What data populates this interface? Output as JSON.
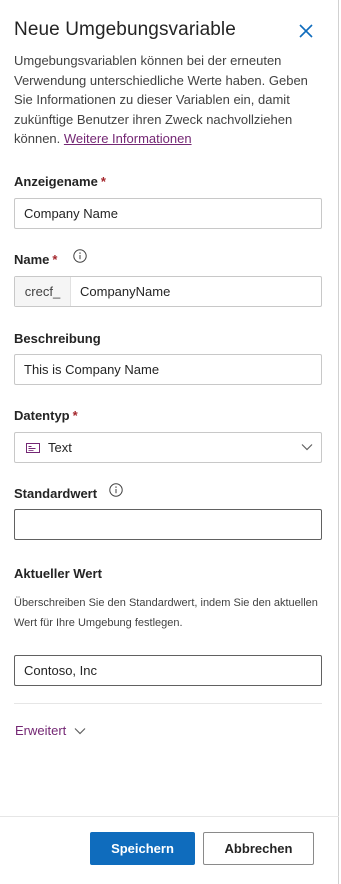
{
  "header": {
    "title": "Neue Umgebungsvariable",
    "close_icon": "close-icon"
  },
  "description": {
    "text": "Umgebungsvariablen können bei der erneuten Verwendung unterschiedliche Werte haben. Geben Sie Informationen zu dieser Variablen ein, damit zukünftige Benutzer ihren Zweck nachvollziehen können.",
    "link": "Weitere Informationen"
  },
  "fields": {
    "display_name": {
      "label": "Anzeigename",
      "required": "*",
      "value": "Company Name"
    },
    "name": {
      "label": "Name",
      "required": "*",
      "prefix": "crecf_",
      "value": "CompanyName",
      "info_icon": "info-icon"
    },
    "description": {
      "label": "Beschreibung",
      "value": "This is Company Name"
    },
    "data_type": {
      "label": "Datentyp",
      "required": "*",
      "value": "Text",
      "icon": "text-type-icon",
      "chevron": "chevron-down-icon"
    },
    "default_value": {
      "label": "Standardwert",
      "value": "",
      "info_icon": "info-icon"
    },
    "current_value": {
      "label": "Aktueller Wert",
      "hint": "Überschreiben Sie den Standardwert, indem Sie den aktuellen Wert für Ihre Umgebung festlegen.",
      "value": "Contoso, Inc"
    }
  },
  "advanced": {
    "label": "Erweitert",
    "icon": "chevron-down-icon"
  },
  "footer": {
    "save_label": "Speichern",
    "cancel_label": "Abbrechen"
  },
  "colors": {
    "primary": "#0f6cbd",
    "link": "#742774",
    "required": "#a4262c"
  }
}
